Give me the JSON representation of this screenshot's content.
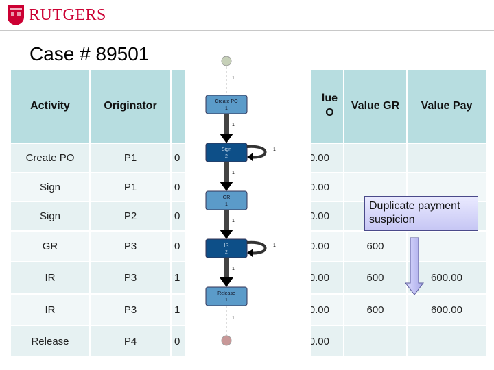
{
  "logo": {
    "text": "RUTGERS"
  },
  "title": "Case # 89501",
  "table": {
    "headers": [
      "Activity",
      "Originator",
      "",
      "Value PO",
      "Value GR",
      "Value Pay"
    ],
    "header_visible": {
      "value_po": "lue\nO"
    },
    "rows": [
      [
        "Create PO",
        "P1",
        "0",
        "0.00",
        "",
        ""
      ],
      [
        "Sign",
        "P1",
        "0",
        "0.00",
        "",
        ""
      ],
      [
        "Sign",
        "P2",
        "0",
        "0.00",
        "",
        ""
      ],
      [
        "GR",
        "P3",
        "0",
        "0.00",
        "600",
        ""
      ],
      [
        "IR",
        "P3",
        "1",
        "0.00",
        "600",
        "600.00"
      ],
      [
        "IR",
        "P3",
        "1",
        "0.00",
        "600",
        "600.00"
      ],
      [
        "Release",
        "P4",
        "0",
        "0.00",
        "",
        ""
      ]
    ]
  },
  "process_map": {
    "nodes": [
      {
        "label": "Create PO",
        "count": "1"
      },
      {
        "label": "Sign",
        "count": "2"
      },
      {
        "label": "GR",
        "count": "1"
      },
      {
        "label": "IR",
        "count": "2"
      },
      {
        "label": "Release",
        "count": "1"
      }
    ],
    "edge_label": "1",
    "colors": {
      "light": "#5b9bc9",
      "dark": "#0d4f88"
    }
  },
  "callout": {
    "text": "Duplicate payment suspicion"
  },
  "colors": {
    "header": "#b7dde0",
    "brand": "#cc0033"
  }
}
